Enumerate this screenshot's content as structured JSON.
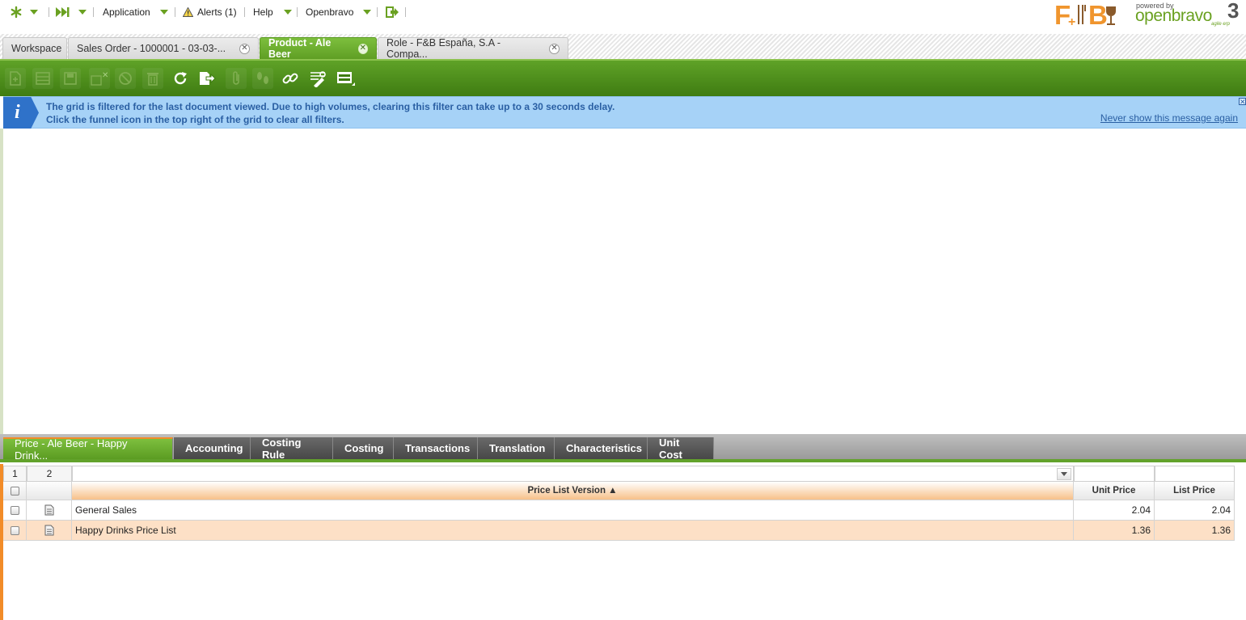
{
  "topnav": {
    "application": "Application",
    "alerts": "Alerts (1)",
    "help": "Help",
    "user": "Openbravo",
    "brand_powered": "powered by",
    "brand_name": "openbravo",
    "brand_tagline": "agile erp",
    "brand_version": "3",
    "company_logo": "F+B"
  },
  "tabs": [
    {
      "label": "Workspace"
    },
    {
      "label": "Sales Order - 1000001 - 03-03-..."
    },
    {
      "label": "Product - Ale Beer"
    },
    {
      "label": "Role - F&B España, S.A - Compa..."
    }
  ],
  "message": {
    "line1": "The grid is filtered for the last document viewed. Due to high volumes, clearing this filter can take up to a 30 seconds delay.",
    "line2": "Click the funnel icon in the top right of the grid to clear all filters.",
    "link": "Never show this message again"
  },
  "subtabs": [
    {
      "label": "Price - Ale Beer - Happy Drink..."
    },
    {
      "label": "Accounting"
    },
    {
      "label": "Costing Rule"
    },
    {
      "label": "Costing"
    },
    {
      "label": "Transactions"
    },
    {
      "label": "Translation"
    },
    {
      "label": "Characteristics"
    },
    {
      "label": "Unit Cost"
    }
  ],
  "grid": {
    "col_num_1": "1",
    "col_num_2": "2",
    "headers": {
      "price_list_version": "Price List Version ▲",
      "unit_price": "Unit Price",
      "list_price": "List Price"
    },
    "rows": [
      {
        "price_list_version": "General Sales",
        "unit_price": "2.04",
        "list_price": "2.04"
      },
      {
        "price_list_version": "Happy Drinks Price List",
        "unit_price": "1.36",
        "list_price": "1.36"
      }
    ]
  },
  "colors": {
    "green": "#5fa227",
    "orange": "#f28c28",
    "info_blue": "#a6d2f7"
  }
}
